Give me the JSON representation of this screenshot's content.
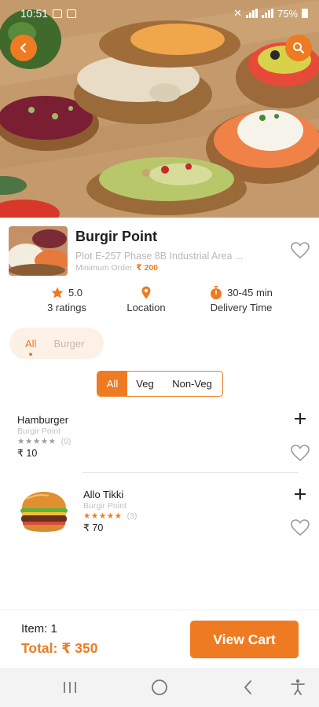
{
  "status_bar": {
    "time": "10:51",
    "battery": "75%"
  },
  "restaurant": {
    "name": "Burgir Point",
    "address": "Plot E-257 Phase 8B Industrial Area ...",
    "min_order_label": "Minimum Order",
    "min_order_value": "₹ 200",
    "rating": "5.0",
    "ratings_label": "3 ratings",
    "location_label": "Location",
    "delivery_time": "30-45 min",
    "delivery_time_label": "Delivery Time"
  },
  "categories": {
    "all": "All",
    "burger": "Burger"
  },
  "veg_filter": {
    "all": "All",
    "veg": "Veg",
    "non_veg": "Non-Veg",
    "selected": "All"
  },
  "items": [
    {
      "name": "Hamburger",
      "restaurant": "Burgir Point",
      "stars": "★★★★★",
      "rating_count": "(0)",
      "price": "₹ 10"
    },
    {
      "name": "Allo Tikki",
      "restaurant": "Burgir Point",
      "stars": "★★★★★",
      "rating_count": "(3)",
      "price": "₹ 70"
    }
  ],
  "cart": {
    "items_label": "Item: 1",
    "total_label": "Total: ₹ 350",
    "button": "View Cart"
  },
  "colors": {
    "accent": "#ee7b22",
    "star_empty": "#9e9e9e"
  },
  "icons": [
    "back-arrow-icon",
    "search-icon",
    "star-icon",
    "location-pin-icon",
    "timer-icon",
    "heart-icon",
    "plus-icon"
  ]
}
